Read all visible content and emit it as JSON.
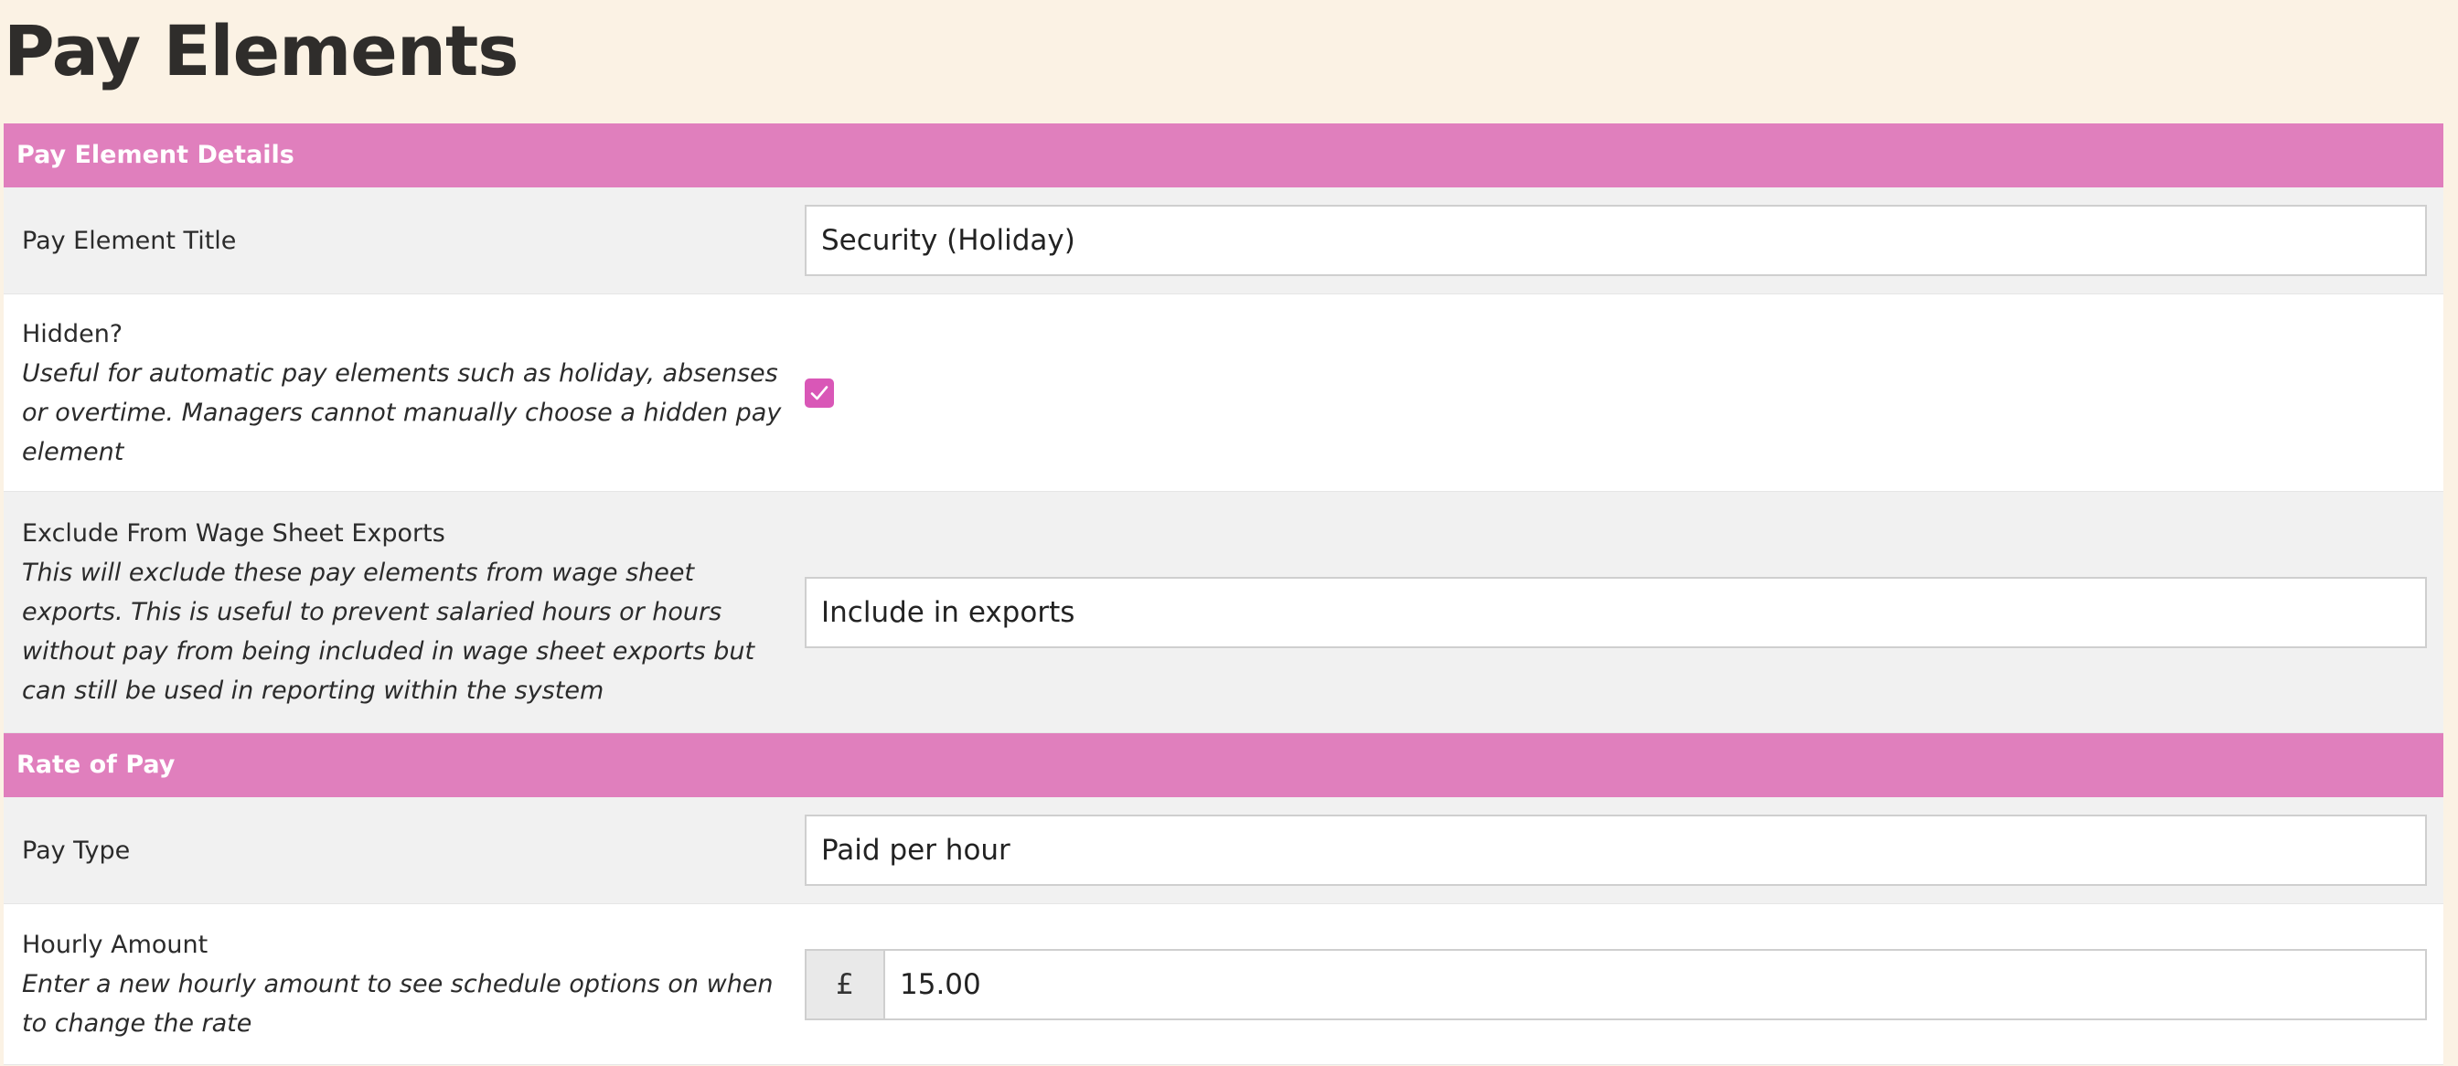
{
  "page": {
    "title": "Pay Elements"
  },
  "sections": {
    "details": {
      "header": "Pay Element Details",
      "title_field": {
        "label": "Pay Element Title",
        "value": "Security (Holiday)"
      },
      "hidden_field": {
        "label": "Hidden?",
        "help": "Useful for automatic pay elements such as holiday, absenses or overtime. Managers cannot manually choose a hidden pay element",
        "checked": true
      },
      "exclude_field": {
        "label": "Exclude From Wage Sheet Exports",
        "help": "This will exclude these pay elements from wage sheet exports. This is useful to prevent salaried hours or hours without pay from being included in wage sheet exports but can still be used in reporting within the system",
        "value": "Include in exports"
      }
    },
    "rate": {
      "header": "Rate of Pay",
      "pay_type": {
        "label": "Pay Type",
        "value": "Paid per hour"
      },
      "hourly_amount": {
        "label": "Hourly Amount",
        "help": "Enter a new hourly amount to see schedule options on when to change the rate",
        "currency": "£",
        "value": "15.00"
      }
    }
  },
  "colors": {
    "background": "#fbf2e4",
    "section_header": "#e07fbd",
    "checkbox": "#d957b7"
  },
  "icons": {
    "checkbox": "checkmark-icon"
  }
}
